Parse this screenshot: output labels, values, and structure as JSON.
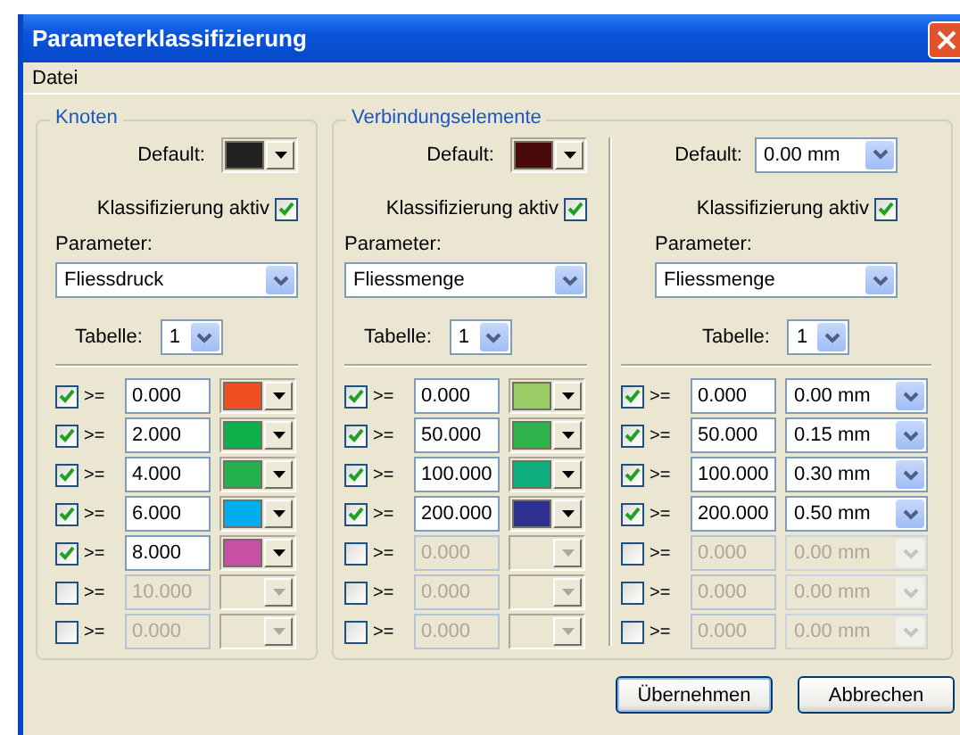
{
  "window": {
    "title": "Parameterklassifizierung"
  },
  "menu": [
    {
      "label": "Datei"
    }
  ],
  "groups": [
    {
      "title": "Knoten",
      "columns": [
        {
          "kind": "color",
          "default": {
            "label": "Default:",
            "color": "#222222"
          },
          "active_label": "Klassifizierung aktiv",
          "active": true,
          "parameter_label": "Parameter:",
          "parameter": "Fliessdruck",
          "table_label": "Tabelle:",
          "table": "1",
          "rows": [
            {
              "checked": true,
              "operator": ">=",
              "value": "0.000",
              "color": "#f04e23"
            },
            {
              "checked": true,
              "operator": ">=",
              "value": "2.000",
              "color": "#0db04b"
            },
            {
              "checked": true,
              "operator": ">=",
              "value": "4.000",
              "color": "#22b14c"
            },
            {
              "checked": true,
              "operator": ">=",
              "value": "6.000",
              "color": "#00aeef"
            },
            {
              "checked": true,
              "operator": ">=",
              "value": "8.000",
              "color": "#c550a4"
            },
            {
              "checked": false,
              "operator": ">=",
              "value": "10.000"
            },
            {
              "checked": false,
              "operator": ">=",
              "value": "0.000"
            }
          ]
        }
      ]
    },
    {
      "title": "Verbindungselemente",
      "columns": [
        {
          "kind": "color",
          "default": {
            "label": "Default:",
            "color": "#4a0a0a"
          },
          "active_label": "Klassifizierung aktiv",
          "active": true,
          "parameter_label": "Parameter:",
          "parameter": "Fliessmenge",
          "table_label": "Tabelle:",
          "table": "1",
          "rows": [
            {
              "checked": true,
              "operator": ">=",
              "value": "0.000",
              "color": "#99cc66"
            },
            {
              "checked": true,
              "operator": ">=",
              "value": "50.000",
              "color": "#2db34a"
            },
            {
              "checked": true,
              "operator": ">=",
              "value": "100.000",
              "color": "#0fae7e"
            },
            {
              "checked": true,
              "operator": ">=",
              "value": "200.000",
              "color": "#2e3192"
            },
            {
              "checked": false,
              "operator": ">=",
              "value": "0.000"
            },
            {
              "checked": false,
              "operator": ">=",
              "value": "0.000"
            },
            {
              "checked": false,
              "operator": ">=",
              "value": "0.000"
            }
          ]
        },
        {
          "kind": "size",
          "default": {
            "label": "Default:",
            "value": "0.00 mm"
          },
          "active_label": "Klassifizierung aktiv",
          "active": true,
          "parameter_label": "Parameter:",
          "parameter": "Fliessmenge",
          "table_label": "Tabelle:",
          "table": "1",
          "rows": [
            {
              "checked": true,
              "operator": ">=",
              "value": "0.000",
              "size": "0.00 mm"
            },
            {
              "checked": true,
              "operator": ">=",
              "value": "50.000",
              "size": "0.15 mm"
            },
            {
              "checked": true,
              "operator": ">=",
              "value": "100.000",
              "size": "0.30 mm"
            },
            {
              "checked": true,
              "operator": ">=",
              "value": "200.000",
              "size": "0.50 mm"
            },
            {
              "checked": false,
              "operator": ">=",
              "value": "0.000",
              "size": "0.00 mm"
            },
            {
              "checked": false,
              "operator": ">=",
              "value": "0.000",
              "size": "0.00 mm"
            },
            {
              "checked": false,
              "operator": ">=",
              "value": "0.000",
              "size": "0.00 mm"
            }
          ]
        }
      ]
    }
  ],
  "buttons": [
    {
      "label": "Übernehmen",
      "default": true
    },
    {
      "label": "Abbrechen",
      "default": false
    }
  ]
}
